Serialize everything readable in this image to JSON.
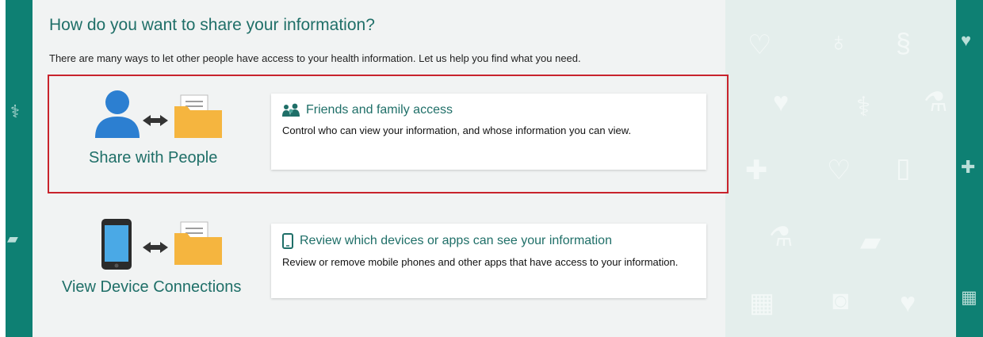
{
  "header": {
    "title": "How do you want to share your information?",
    "intro": "There are many ways to let other people have access to your health information. Let us help you find what you need."
  },
  "options": [
    {
      "label": "Share with People",
      "card_title": "Friends and family access",
      "card_description": "Control who can view your information, and whose information you can view.",
      "icon": "people-icon",
      "highlighted": true
    },
    {
      "label": "View Device Connections",
      "card_title": "Review which devices or apps can see your information",
      "card_description": "Review or remove mobile phones and other apps that have access to your information.",
      "icon": "mobile-phone-icon",
      "highlighted": false
    }
  ],
  "colors": {
    "teal": "#1f6f68",
    "band": "#0e8073",
    "highlight_border": "#c8232c",
    "person_blue": "#2c7fd1",
    "folder_yellow": "#f5b53f"
  }
}
